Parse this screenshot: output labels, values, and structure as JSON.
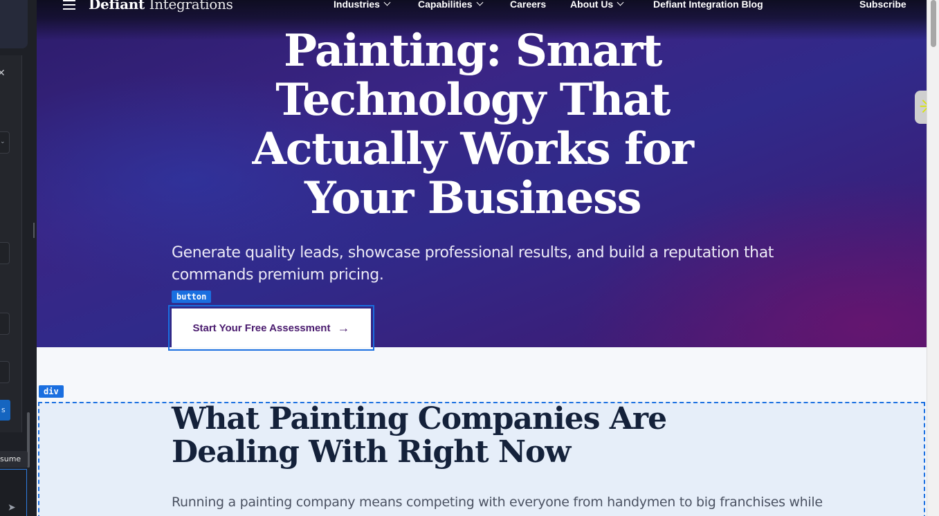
{
  "editor_panel": {
    "resume_label": "sume",
    "blue_button_label": "s"
  },
  "nav": {
    "brand_strong": "Defiant",
    "brand_light": "Integrations",
    "items": [
      {
        "label": "Industries"
      },
      {
        "label": "Capabilities"
      },
      {
        "label": "Careers"
      },
      {
        "label": "About Us"
      },
      {
        "label": "Defiant Integration Blog"
      },
      {
        "label": "Subscribe"
      }
    ]
  },
  "hero": {
    "title_lines": [
      "Painting: Smart",
      "Technology That",
      "Actually Works for",
      "Your Business"
    ],
    "subtitle_line1": "Generate quality leads, showcase professional results, and build a reputation that",
    "subtitle_line2": "commands premium pricing.",
    "cta_label": "Start Your Free Assessment",
    "cta_arrow": "→"
  },
  "dev_overlay": {
    "button_tag": "button",
    "div_tag": "div"
  },
  "section2": {
    "title_line1": "What Painting Companies Are",
    "title_line2": "Dealing With Right Now",
    "body_line1": "Running a painting company means competing with everyone from handymen to big franchises while"
  },
  "colors": {
    "hero_purple": "#3a2585",
    "cta_text": "#4a1b6e",
    "selection_blue": "#1a6fe0",
    "section_title": "#14213a"
  },
  "icons": [
    "hamburger-menu-icon",
    "chevron-down-icon",
    "arrow-right-icon",
    "close-icon",
    "send-icon",
    "asterisk-widget-icon"
  ]
}
